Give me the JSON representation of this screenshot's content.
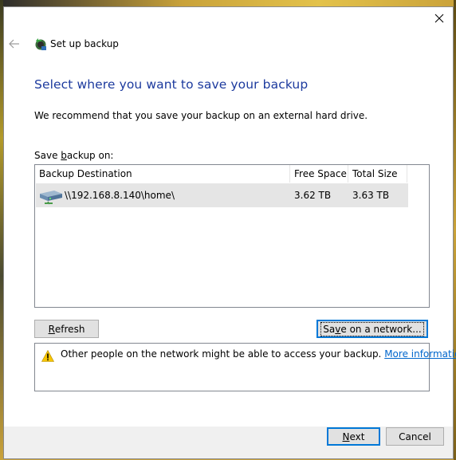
{
  "window": {
    "title": "Set up backup",
    "close_symbol": "✕"
  },
  "content": {
    "heading": "Select where you want to save your backup",
    "subtitle": "We recommend that you save your backup on an external hard drive.",
    "save_on_label_pre": "Save ",
    "save_on_label_accel": "b",
    "save_on_label_post": "ackup on:"
  },
  "table": {
    "columns": [
      "Backup Destination",
      "Free Space",
      "Total Size"
    ],
    "rows": [
      {
        "destination": "\\\\192.168.8.140\\home\\",
        "free_space": "3.62 TB",
        "total_size": "3.63 TB",
        "icon": "network-drive-icon"
      }
    ]
  },
  "buttons": {
    "refresh_accel": "R",
    "refresh_rest": "efresh",
    "network_pre": "Sa",
    "network_accel": "v",
    "network_post": "e on a network...",
    "next_accel": "N",
    "next_rest": "ext",
    "cancel": "Cancel"
  },
  "warning": {
    "icon": "warning-icon",
    "text": "Other people on the network might be able to access your backup.",
    "link": "More information"
  },
  "colors": {
    "heading": "#1c3a9e",
    "link": "#0066cc",
    "focus_border": "#0078d7",
    "row_selected": "#e5e5e5"
  }
}
